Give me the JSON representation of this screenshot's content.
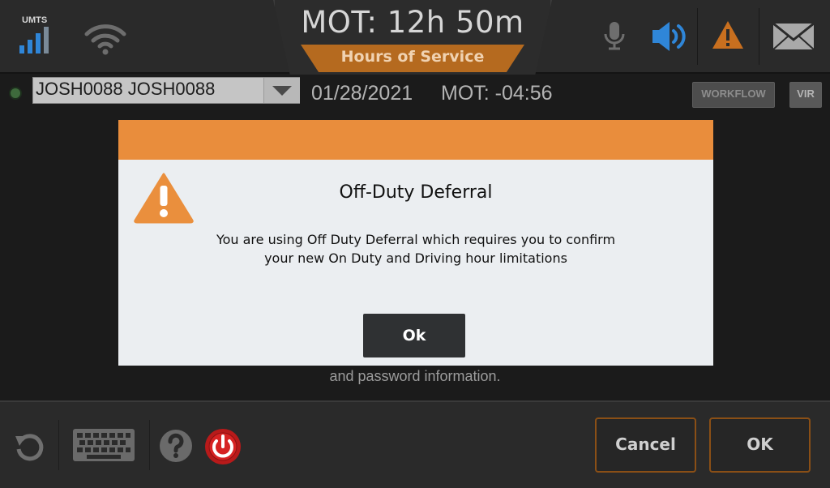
{
  "status_bar": {
    "network_label": "UMTS",
    "mot_title": "MOT: 12h 50m",
    "hos_tab": "Hours of Service",
    "icons": [
      "signal-bars-icon",
      "wifi-icon",
      "microphone-icon",
      "speaker-icon",
      "warning-icon",
      "mail-icon"
    ],
    "accent_color": "#b56a1f",
    "speaker_color": "#2f86d8",
    "warning_color": "#c86f1f"
  },
  "driver_row": {
    "driver": "JOSH0088 JOSH0088",
    "date": "01/28/2021",
    "mot_offset": "MOT: -04:56",
    "workflow_label": "WORKFLOW",
    "vir_label": "VIR"
  },
  "background_message": "and password information.",
  "dialog": {
    "title": "Off-Duty Deferral",
    "message_line1": "You are using Off Duty Deferral which requires you to confirm",
    "message_line2": "your new On Duty and Driving hour limitations",
    "ok_label": "Ok",
    "header_color": "#e98d3c"
  },
  "bottom_bar": {
    "icons": [
      "refresh-icon",
      "keyboard-icon",
      "help-icon",
      "power-icon"
    ],
    "cancel_label": "Cancel",
    "ok_label": "OK"
  }
}
